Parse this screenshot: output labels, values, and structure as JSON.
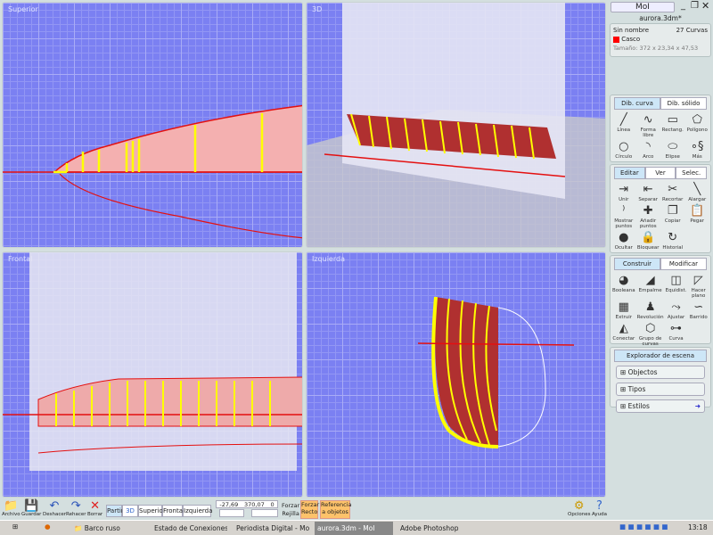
{
  "viewports": {
    "top": "Superior",
    "persp": "3D",
    "front": "Frontal",
    "left": "Izquierda"
  },
  "side": {
    "app": "MoI",
    "file": "aurora.3dm*",
    "info": {
      "name": "Sin nombre",
      "count": "27 Curvas",
      "layer": "Casco",
      "layer_color": "#ff0000",
      "size": "Tamaño:  372 x 23,34 x 47,53"
    },
    "draw_tabs": [
      "Dib. curva",
      "Dib. sólido"
    ],
    "draw_tools": [
      {
        "label": "Línea",
        "icon": "line-icon",
        "glyph": "╱"
      },
      {
        "label": "Forma libre",
        "icon": "freeform-icon",
        "glyph": "∿"
      },
      {
        "label": "Rectang.",
        "icon": "rectangle-icon",
        "glyph": "▭"
      },
      {
        "label": "Polígono",
        "icon": "polygon-icon",
        "glyph": "⬠"
      },
      {
        "label": "Círculo",
        "icon": "circle-icon",
        "glyph": "○"
      },
      {
        "label": "Arco",
        "icon": "arc-icon",
        "glyph": "◝"
      },
      {
        "label": "Elipse",
        "icon": "ellipse-icon",
        "glyph": "⬭"
      },
      {
        "label": "Más",
        "icon": "more-icon",
        "glyph": "∘§"
      }
    ],
    "edit_tabs": [
      "Editar",
      "Ver",
      "Selec."
    ],
    "edit_tools": [
      {
        "label": "Unir",
        "icon": "join-icon",
        "glyph": "⇥"
      },
      {
        "label": "Separar",
        "icon": "separate-icon",
        "glyph": "⇤"
      },
      {
        "label": "Recortar",
        "icon": "trim-icon",
        "glyph": "✂"
      },
      {
        "label": "Alargar",
        "icon": "extend-icon",
        "glyph": "╲"
      },
      {
        "label": "Mostrar puntos",
        "icon": "show-points-icon",
        "glyph": "⁾"
      },
      {
        "label": "Añadir puntos",
        "icon": "add-points-icon",
        "glyph": "✚"
      },
      {
        "label": "Copiar",
        "icon": "copy-icon",
        "glyph": "❐"
      },
      {
        "label": "Pegar",
        "icon": "paste-icon",
        "glyph": "📋"
      },
      {
        "label": "Ocultar",
        "icon": "hide-icon",
        "glyph": "●"
      },
      {
        "label": "Bloquear",
        "icon": "lock-icon",
        "glyph": "🔒"
      },
      {
        "label": "Historial",
        "icon": "history-icon",
        "glyph": "↻"
      }
    ],
    "build_tabs": [
      "Construir",
      "Modificar"
    ],
    "build_tools": [
      {
        "label": "Booleana",
        "icon": "boolean-icon",
        "glyph": "◕"
      },
      {
        "label": "Empalme",
        "icon": "fillet-icon",
        "glyph": "◢"
      },
      {
        "label": "Equidist.",
        "icon": "offset-icon",
        "glyph": "◫"
      },
      {
        "label": "Hacer plano",
        "icon": "planar-icon",
        "glyph": "◸"
      },
      {
        "label": "Extruir",
        "icon": "extrude-icon",
        "glyph": "▦"
      },
      {
        "label": "Revolución",
        "icon": "revolve-icon",
        "glyph": "♟"
      },
      {
        "label": "Ajustar",
        "icon": "sweep-icon",
        "glyph": "⤳"
      },
      {
        "label": "Barrido",
        "icon": "loft-icon",
        "glyph": "∽"
      },
      {
        "label": "Conectar",
        "icon": "connect-icon",
        "glyph": "◭"
      },
      {
        "label": "Grupo de curvas",
        "icon": "network-icon",
        "glyph": "⬡"
      },
      {
        "label": "Curva",
        "icon": "curve-icon",
        "glyph": "⊶"
      }
    ],
    "explorer": {
      "title": "Explorador de escena",
      "items": [
        "Objectos",
        "Tipos",
        "Estilos"
      ]
    }
  },
  "toolbar": {
    "buttons": [
      {
        "label": "Archivo",
        "icon": "folder-icon",
        "glyph": "📁"
      },
      {
        "label": "Guardar",
        "icon": "save-icon",
        "glyph": "💾"
      },
      {
        "label": "Deshacer",
        "icon": "undo-icon",
        "glyph": "↶"
      },
      {
        "label": "Rehacer",
        "icon": "redo-icon",
        "glyph": "↷"
      },
      {
        "label": "Borrar",
        "icon": "delete-icon",
        "glyph": "✕"
      }
    ],
    "views": [
      "Partir",
      "3D",
      "Superior",
      "Frontal",
      "Izquierda"
    ],
    "coords": {
      "x": "-27,69",
      "y": "370,07",
      "z": "0"
    },
    "snap": {
      "label1": "Forzar",
      "label2": "Rejilla"
    },
    "ortho": "Forzar Recto",
    "objref": "Referencia a objetos",
    "options": "Opciones",
    "help": "Ayuda"
  },
  "taskbar": {
    "items": [
      "Barco ruso",
      "Estado de Conexiones ...",
      "Periodista Digital - Mozil...",
      "aurora.3dm - MoI",
      "Adobe Photoshop"
    ],
    "clock": "13:18"
  }
}
